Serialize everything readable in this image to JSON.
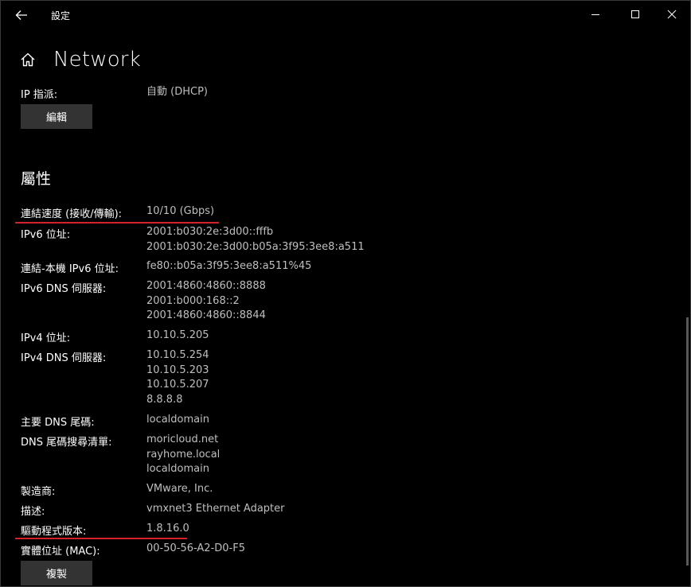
{
  "window": {
    "title": "設定",
    "back_icon": "back-arrow-icon",
    "controls": [
      "minimize-icon",
      "maximize-icon",
      "close-icon"
    ]
  },
  "header": {
    "title": "Network",
    "icon": "home-icon"
  },
  "ip_assignment": {
    "label": "IP 指派:",
    "value": "自動 (DHCP)",
    "edit_label": "編輯"
  },
  "properties": {
    "title": "屬性",
    "link_speed": {
      "label": "連結速度 (接收/傳輸):",
      "value": "10/10 (Gbps)"
    },
    "ipv6_address": {
      "label": "IPv6 位址:",
      "values": [
        "2001:b030:2e:3d00::fffb",
        "2001:b030:2e:3d00:b05a:3f95:3ee8:a511"
      ]
    },
    "link_local_ipv6": {
      "label": "連結-本機 IPv6 位址:",
      "value": "fe80::b05a:3f95:3ee8:a511%45"
    },
    "ipv6_dns": {
      "label": "IPv6 DNS 伺服器:",
      "values": [
        "2001:4860:4860::8888",
        "2001:b000:168::2",
        "2001:4860:4860::8844"
      ]
    },
    "ipv4_address": {
      "label": "IPv4 位址:",
      "value": "10.10.5.205"
    },
    "ipv4_dns": {
      "label": "IPv4 DNS 伺服器:",
      "values": [
        "10.10.5.254",
        "10.10.5.203",
        "10.10.5.207",
        "8.8.8.8"
      ]
    },
    "primary_dns_suffix": {
      "label": "主要 DNS 尾碼:",
      "value": "localdomain"
    },
    "dns_suffix_search": {
      "label": "DNS 尾碼搜尋清單:",
      "values": [
        "moricloud.net",
        "rayhome.local",
        "localdomain"
      ]
    },
    "manufacturer": {
      "label": "製造商:",
      "value": "VMware, Inc."
    },
    "description": {
      "label": "描述:",
      "value": "vmxnet3 Ethernet Adapter"
    },
    "driver_version": {
      "label": "驅動程式版本:",
      "value": "1.8.16.0"
    },
    "mac_address": {
      "label": "實體位址 (MAC):",
      "value": "00-50-56-A2-D0-F5"
    },
    "copy_label": "複製"
  },
  "colors": {
    "background": "#000000",
    "button": "#333333",
    "annotation": "#d4202b",
    "value_text": "#bfbfbf"
  }
}
